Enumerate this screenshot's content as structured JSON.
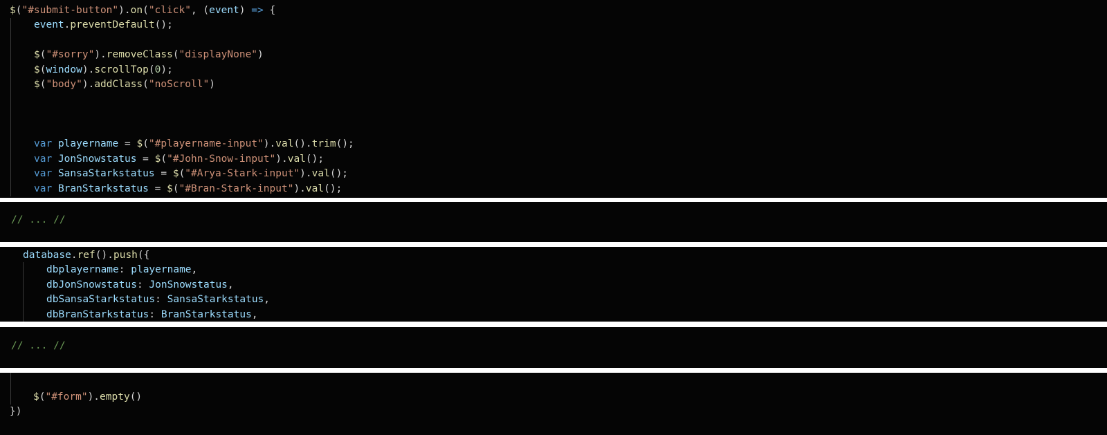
{
  "block1": {
    "l1": {
      "a": "$",
      "b": "(",
      "c": "\"#submit-button\"",
      "d": ").",
      "e": "on",
      "f": "(",
      "g": "\"click\"",
      "h": ", (",
      "i": "event",
      "j": ") ",
      "k": "=>",
      "l": " {"
    },
    "l2": {
      "a": "event",
      "b": ".",
      "c": "preventDefault",
      "d": "();"
    },
    "l4": {
      "a": "$",
      "b": "(",
      "c": "\"#sorry\"",
      "d": ").",
      "e": "removeClass",
      "f": "(",
      "g": "\"displayNone\"",
      "h": ")"
    },
    "l5": {
      "a": "$",
      "b": "(",
      "c": "window",
      "d": ").",
      "e": "scrollTop",
      "f": "(",
      "g": "0",
      "h": ");"
    },
    "l6": {
      "a": "$",
      "b": "(",
      "c": "\"body\"",
      "d": ").",
      "e": "addClass",
      "f": "(",
      "g": "\"noScroll\"",
      "h": ")"
    },
    "l10": {
      "kw": "var",
      "name": "playername",
      "eq": " = ",
      "fn": "$",
      "p1": "(",
      "str": "\"#playername-input\"",
      "p2": ").",
      "m1": "val",
      "p3": "().",
      "m2": "trim",
      "p4": "();"
    },
    "l11": {
      "kw": "var",
      "name": "JonSnowstatus",
      "eq": " = ",
      "fn": "$",
      "p1": "(",
      "str": "\"#John-Snow-input\"",
      "p2": ").",
      "m1": "val",
      "p3": "();"
    },
    "l12": {
      "kw": "var",
      "name": "SansaStarkstatus",
      "eq": " = ",
      "fn": "$",
      "p1": "(",
      "str": "\"#Arya-Stark-input\"",
      "p2": ").",
      "m1": "val",
      "p3": "();"
    },
    "l13": {
      "kw": "var",
      "name": "BranStarkstatus",
      "eq": " = ",
      "fn": "$",
      "p1": "(",
      "str": "\"#Bran-Stark-input\"",
      "p2": ").",
      "m1": "val",
      "p3": "();"
    }
  },
  "block2": {
    "comment": "// ... //"
  },
  "block3": {
    "l1": {
      "a": "database",
      "b": ".",
      "c": "ref",
      "d": "().",
      "e": "push",
      "f": "({"
    },
    "l2": {
      "key": "dbplayername",
      "sep": ": ",
      "val": "playername",
      "end": ","
    },
    "l3": {
      "key": "dbJonSnowstatus",
      "sep": ": ",
      "val": "JonSnowstatus",
      "end": ","
    },
    "l4": {
      "key": "dbSansaStarkstatus",
      "sep": ": ",
      "val": "SansaStarkstatus",
      "end": ","
    },
    "l5": {
      "key": "dbBranStarkstatus",
      "sep": ": ",
      "val": "BranStarkstatus",
      "end": ","
    }
  },
  "block4": {
    "comment": "// ... //"
  },
  "block5": {
    "l1": {
      "a": "$",
      "b": "(",
      "c": "\"#form\"",
      "d": ").",
      "e": "empty",
      "f": "()"
    },
    "l2": {
      "a": "})"
    }
  }
}
